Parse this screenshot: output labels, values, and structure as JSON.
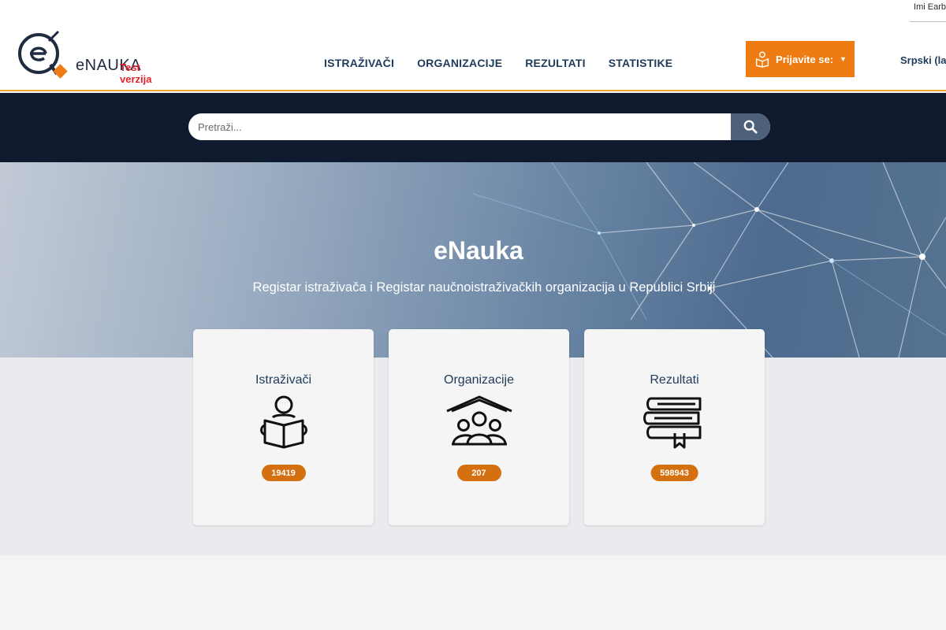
{
  "header": {
    "user_name": "Imi Earb",
    "logo_text": "eNAUKA",
    "test_label": "Test verzija",
    "nav": [
      {
        "label": "ISTRAŽIVAČI"
      },
      {
        "label": "ORGANIZACIJE"
      },
      {
        "label": "REZULTATI"
      },
      {
        "label": "STATISTIKE"
      }
    ],
    "login_label": "Prijavite se:",
    "language": "Srpski (lat",
    "accent_color": "#ee7c12"
  },
  "search": {
    "placeholder": "Pretraži...",
    "button_icon": "search-icon"
  },
  "hero": {
    "title": "eNauka",
    "subtitle": "Registar istraživača i Registar naučnoistraživačkih organizacija u Republici Srbiji"
  },
  "cards": [
    {
      "title": "Istraživači",
      "icon": "reader-icon",
      "count": "19419"
    },
    {
      "title": "Organizacije",
      "icon": "group-house-icon",
      "count": "207"
    },
    {
      "title": "Rezultati",
      "icon": "books-icon",
      "count": "598943"
    }
  ]
}
